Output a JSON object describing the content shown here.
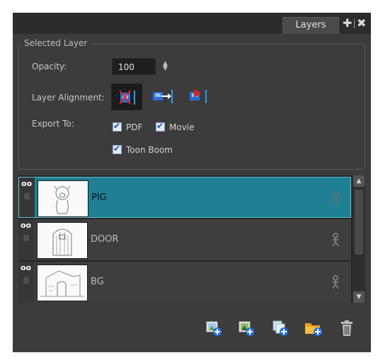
{
  "panel": {
    "tab_label": "Layers",
    "add_icon": "plus-icon",
    "close_icon": "close-icon"
  },
  "selected_layer": {
    "group_title": "Selected Layer",
    "opacity_label": "Opacity:",
    "opacity_value": "100",
    "alignment_label": "Layer Alignment:",
    "alignment_options": [
      "inline",
      "left",
      "right"
    ],
    "export_label": "Export To:",
    "export_options": [
      {
        "label": "PDF",
        "checked": true
      },
      {
        "label": "Movie",
        "checked": true
      },
      {
        "label": "Toon Boom",
        "checked": true
      }
    ]
  },
  "layers": [
    {
      "name": "PIG",
      "selected": true
    },
    {
      "name": "DOOR",
      "selected": false
    },
    {
      "name": "BG",
      "selected": false
    }
  ],
  "toolbar_icons": [
    "add-layer-icon",
    "add-layer-alt-icon",
    "duplicate-layer-icon",
    "new-folder-icon",
    "trash-icon"
  ],
  "colors": {
    "panel_bg": "#3c3c3c",
    "selected_row": "#1f7f93",
    "accent_blue": "#2a6fd6"
  }
}
